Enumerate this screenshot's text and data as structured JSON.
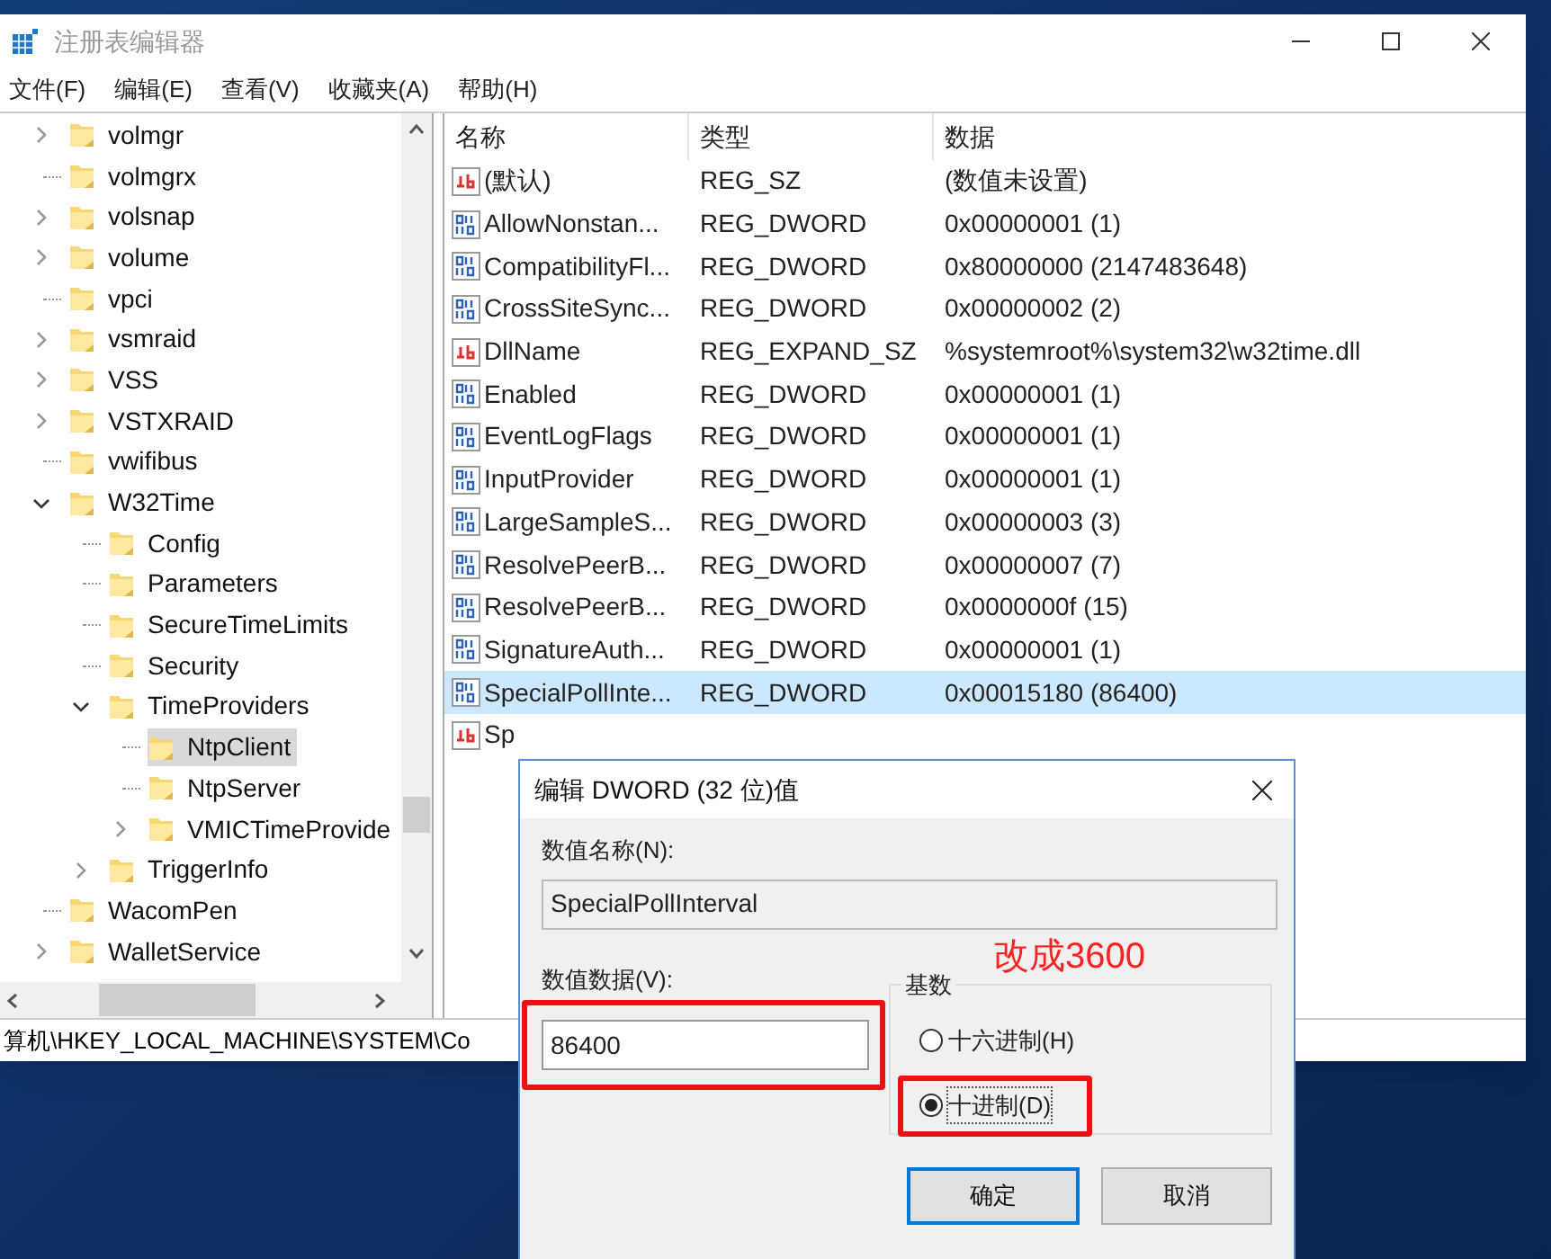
{
  "window": {
    "title": "注册表编辑器"
  },
  "menu": [
    "文件(F)",
    "编辑(E)",
    "查看(V)",
    "收藏夹(A)",
    "帮助(H)"
  ],
  "tree": [
    {
      "label": "volmgr",
      "kind": "branch",
      "expanded": false,
      "selected": false
    },
    {
      "label": "volmgrx",
      "kind": "leaf",
      "selected": false
    },
    {
      "label": "volsnap",
      "kind": "branch",
      "expanded": false,
      "selected": false
    },
    {
      "label": "volume",
      "kind": "branch",
      "expanded": false,
      "selected": false
    },
    {
      "label": "vpci",
      "kind": "leaf",
      "selected": false
    },
    {
      "label": "vsmraid",
      "kind": "branch",
      "expanded": false,
      "selected": false
    },
    {
      "label": "VSS",
      "kind": "branch",
      "expanded": false,
      "selected": false
    },
    {
      "label": "VSTXRAID",
      "kind": "branch",
      "expanded": false,
      "selected": false
    },
    {
      "label": "vwifibus",
      "kind": "leaf",
      "selected": false
    },
    {
      "label": "W32Time",
      "kind": "branch",
      "expanded": true,
      "selected": false,
      "children": [
        {
          "label": "Config",
          "kind": "leaf",
          "selected": false
        },
        {
          "label": "Parameters",
          "kind": "leaf",
          "selected": false
        },
        {
          "label": "SecureTimeLimits",
          "kind": "leaf",
          "selected": false
        },
        {
          "label": "Security",
          "kind": "leaf",
          "selected": false
        },
        {
          "label": "TimeProviders",
          "kind": "branch",
          "expanded": true,
          "selected": false,
          "children": [
            {
              "label": "NtpClient",
              "kind": "leaf",
              "selected": true
            },
            {
              "label": "NtpServer",
              "kind": "leaf",
              "selected": false
            },
            {
              "label": "VMICTimeProvide",
              "kind": "branch",
              "expanded": false,
              "selected": false
            }
          ]
        },
        {
          "label": "TriggerInfo",
          "kind": "branch",
          "expanded": false,
          "selected": false
        }
      ]
    },
    {
      "label": "WacomPen",
      "kind": "leaf",
      "selected": false
    },
    {
      "label": "WalletService",
      "kind": "branch",
      "expanded": false,
      "selected": false
    }
  ],
  "values": {
    "columns": [
      "名称",
      "类型",
      "数据"
    ],
    "rows": [
      {
        "kind": "string",
        "name": "(默认)",
        "type": "REG_SZ",
        "data": "(数值未设置)",
        "selected": false
      },
      {
        "kind": "dword",
        "name": "AllowNonstan...",
        "type": "REG_DWORD",
        "data": "0x00000001 (1)",
        "selected": false
      },
      {
        "kind": "dword",
        "name": "CompatibilityFl...",
        "type": "REG_DWORD",
        "data": "0x80000000 (2147483648)",
        "selected": false
      },
      {
        "kind": "dword",
        "name": "CrossSiteSync...",
        "type": "REG_DWORD",
        "data": "0x00000002 (2)",
        "selected": false
      },
      {
        "kind": "string",
        "name": "DllName",
        "type": "REG_EXPAND_SZ",
        "data": "%systemroot%\\system32\\w32time.dll",
        "selected": false
      },
      {
        "kind": "dword",
        "name": "Enabled",
        "type": "REG_DWORD",
        "data": "0x00000001 (1)",
        "selected": false
      },
      {
        "kind": "dword",
        "name": "EventLogFlags",
        "type": "REG_DWORD",
        "data": "0x00000001 (1)",
        "selected": false
      },
      {
        "kind": "dword",
        "name": "InputProvider",
        "type": "REG_DWORD",
        "data": "0x00000001 (1)",
        "selected": false
      },
      {
        "kind": "dword",
        "name": "LargeSampleS...",
        "type": "REG_DWORD",
        "data": "0x00000003 (3)",
        "selected": false
      },
      {
        "kind": "dword",
        "name": "ResolvePeerB...",
        "type": "REG_DWORD",
        "data": "0x00000007 (7)",
        "selected": false
      },
      {
        "kind": "dword",
        "name": "ResolvePeerB...",
        "type": "REG_DWORD",
        "data": "0x0000000f (15)",
        "selected": false
      },
      {
        "kind": "dword",
        "name": "SignatureAuth...",
        "type": "REG_DWORD",
        "data": "0x00000001 (1)",
        "selected": false
      },
      {
        "kind": "dword",
        "name": "SpecialPollInte...",
        "type": "REG_DWORD",
        "data": "0x00015180 (86400)",
        "selected": true
      },
      {
        "kind": "string",
        "name": "Sp",
        "selected": false
      }
    ]
  },
  "status_bar": {
    "path": "算机\\HKEY_LOCAL_MACHINE\\SYSTEM\\Co"
  },
  "dialog": {
    "title": "编辑 DWORD (32 位)值",
    "name_label": "数值名称(N):",
    "name_value": "SpecialPollInterval",
    "data_label": "数值数据(V):",
    "data_value": "86400",
    "base_label": "基数",
    "data_highlighted": true,
    "radios": [
      {
        "label": "十六进制(H)",
        "selected": false,
        "highlighted": false
      },
      {
        "label": "十进制(D)",
        "selected": true,
        "highlighted": true
      }
    ],
    "buttons": [
      {
        "label": "确定",
        "default": true
      },
      {
        "label": "取消",
        "default": false
      }
    ]
  },
  "annotation": {
    "text": "改成3600"
  }
}
